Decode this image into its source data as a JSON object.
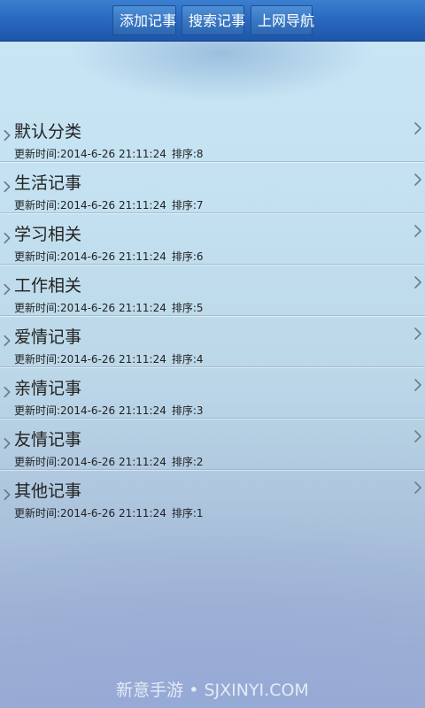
{
  "toolbar": {
    "add_label": "添加记事",
    "search_label": "搜索记事",
    "nav_label": "上网导航"
  },
  "categories": [
    {
      "title": "默认分类",
      "updated_label": "更新时间:",
      "updated": "2014-6-26 21:11:24",
      "sort_label": "排序:",
      "sort": "8"
    },
    {
      "title": "生活记事",
      "updated_label": "更新时间:",
      "updated": "2014-6-26 21:11:24",
      "sort_label": "排序:",
      "sort": "7"
    },
    {
      "title": "学习相关",
      "updated_label": "更新时间:",
      "updated": "2014-6-26 21:11:24",
      "sort_label": "排序:",
      "sort": "6"
    },
    {
      "title": "工作相关",
      "updated_label": "更新时间:",
      "updated": "2014-6-26 21:11:24",
      "sort_label": "排序:",
      "sort": "5"
    },
    {
      "title": "爱情记事",
      "updated_label": "更新时间:",
      "updated": "2014-6-26 21:11:24",
      "sort_label": "排序:",
      "sort": "4"
    },
    {
      "title": "亲情记事",
      "updated_label": "更新时间:",
      "updated": "2014-6-26 21:11:24",
      "sort_label": "排序:",
      "sort": "3"
    },
    {
      "title": "友情记事",
      "updated_label": "更新时间:",
      "updated": "2014-6-26 21:11:24",
      "sort_label": "排序:",
      "sort": "2"
    },
    {
      "title": "其他记事",
      "updated_label": "更新时间:",
      "updated": "2014-6-26 21:11:24",
      "sort_label": "排序:",
      "sort": "1"
    }
  ],
  "watermark": "新意手游 • SJXINYI.COM",
  "icons": {
    "row_left": "chevron-right-icon",
    "row_right": "chevron-right-icon"
  },
  "colors": {
    "topbar": "#2a69c0",
    "button": "#3a78c4",
    "text": "#222222",
    "chevron": "#6d7d8a"
  }
}
